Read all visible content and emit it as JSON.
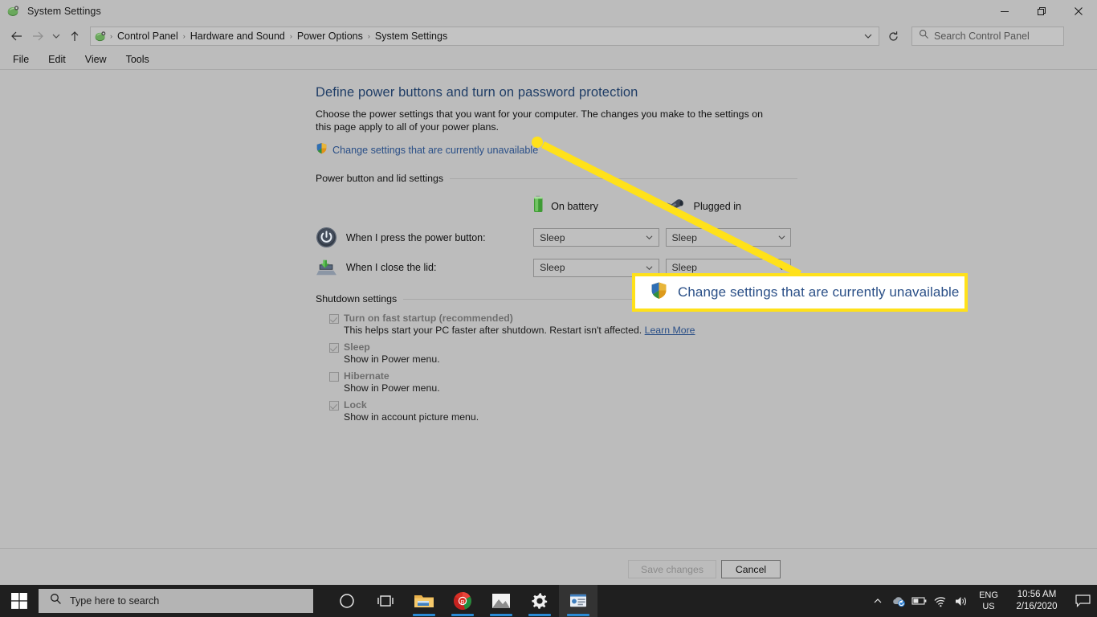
{
  "window": {
    "title": "System Settings",
    "icon": "control-panel-icon",
    "controls": {
      "minimize": "Minimize",
      "restore": "Restore",
      "close": "Close"
    }
  },
  "address_bar": {
    "back": "Back",
    "forward": "Forward",
    "recent": "Recent locations",
    "up": "Up",
    "breadcrumbs": [
      "Control Panel",
      "Hardware and Sound",
      "Power Options",
      "System Settings"
    ],
    "separator": "›",
    "refresh": "Refresh",
    "search": {
      "placeholder": "Search Control Panel",
      "value": ""
    }
  },
  "menu": {
    "items": [
      "File",
      "Edit",
      "View",
      "Tools"
    ]
  },
  "main": {
    "title": "Define power buttons and turn on password protection",
    "description": "Choose the power settings that you want for your computer. The changes you make to the settings on this page apply to all of your power plans.",
    "uac_link": "Change settings that are currently unavailable",
    "power_section": {
      "heading": "Power button and lid settings",
      "columns": [
        {
          "label": "On battery",
          "icon": "battery-icon"
        },
        {
          "label": "Plugged in",
          "icon": "power-plug-icon"
        }
      ],
      "rows": [
        {
          "icon": "power-button-icon",
          "label": "When I press the power button:",
          "on_battery": "Sleep",
          "plugged_in": "Sleep"
        },
        {
          "icon": "laptop-lid-icon",
          "label": "When I close the lid:",
          "on_battery": "Sleep",
          "plugged_in": "Sleep"
        }
      ]
    },
    "shutdown_section": {
      "heading": "Shutdown settings",
      "items": [
        {
          "label": "Turn on fast startup (recommended)",
          "checked": true,
          "description": "This helps start your PC faster after shutdown. Restart isn't affected.",
          "link": "Learn More"
        },
        {
          "label": "Sleep",
          "checked": true,
          "description": "Show in Power menu.",
          "link": ""
        },
        {
          "label": "Hibernate",
          "checked": false,
          "description": "Show in Power menu.",
          "link": ""
        },
        {
          "label": "Lock",
          "checked": true,
          "description": "Show in account picture menu.",
          "link": ""
        }
      ]
    }
  },
  "footer": {
    "save_label": "Save changes",
    "save_enabled": false,
    "cancel_label": "Cancel"
  },
  "annotation": {
    "callout_text": "Change settings that are currently unavailable",
    "callout_icon": "uac-shield-icon",
    "highlight_color": "#ffe11a",
    "text_color": "#2a4f87"
  },
  "taskbar": {
    "start": "start-button",
    "search_placeholder": "Type here to search",
    "icons": [
      "cortana-icon",
      "task-view-icon",
      "file-explorer-icon",
      "google-chrome-icon",
      "photos-icon",
      "settings-gear-icon",
      "control-panel-icon"
    ],
    "tray": {
      "overflow": "show-hidden-icons",
      "icons": [
        "onedrive-sync-icon",
        "battery-icon",
        "wifi-icon",
        "volume-icon"
      ],
      "language_line1": "ENG",
      "language_line2": "US",
      "time": "10:56 AM",
      "date": "2/16/2020",
      "notifications": "notification-center-icon"
    }
  }
}
